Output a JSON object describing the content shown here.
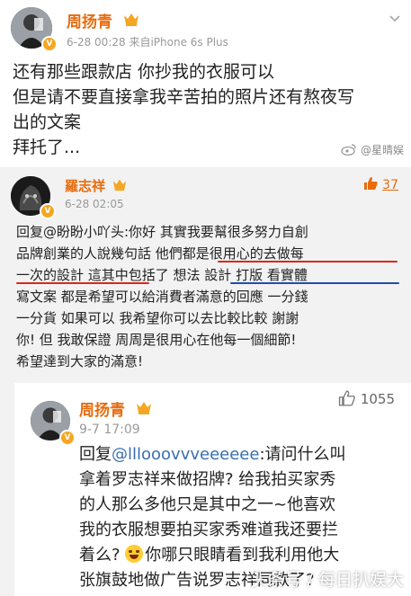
{
  "post1": {
    "username": "周扬青",
    "meta": "6-28 00:28  来自iPhone 6s Plus",
    "lines": [
      "还有那些跟款店 你抄我的衣服可以",
      "但是请不要直接拿我辛苦拍的照片还有熬夜写",
      "出的文案",
      "拜托了..."
    ],
    "watermark": "@星晴娱"
  },
  "post2": {
    "username": "羅志祥",
    "meta": "6-28 02:05",
    "like_count": "37",
    "lines": [
      "回复@盼盼小吖头:你好 其實我要幫很多努力自創",
      "品牌創業的人說幾句話 他們都是很用心的去做每",
      "一次的設計 這其中包括了 想法 設計 打版 看實體",
      "寫文案 都是希望可以給消費者滿意的回應 一分錢",
      "一分貨 如果可以 我希望你可以去比較比較 謝謝",
      "你! 但 我敢保證 周周是很用心在他每一個細節!",
      "希望達到大家的滿意!"
    ]
  },
  "post3": {
    "username": "周扬青",
    "meta": "9-7 17:09",
    "like_count": "1055",
    "reply_prefix": "回复",
    "mention": "@lllooovvveeeeee",
    "line1_rest": ":请问什么叫",
    "lines": [
      "拿着罗志祥来做招牌? 给我拍买家秀",
      "的人那么多他只是其中之一~他喜欢",
      "我的衣服想要拍买家秀难道我还要拦"
    ],
    "line5_before": "着么? ",
    "line5_after": "你哪只眼睛看到我利用他大",
    "line6": "张旗鼓地做广告说罗志祥同款了?",
    "watermark": "头条号 / 每日扒娱大"
  },
  "icons": [
    "chevron-down-icon",
    "verified-badge-icon",
    "thumbs-up-icon",
    "weibo-logo-icon",
    "laugh-cry-emoji-icon"
  ],
  "colors": {
    "username": "#e86b0c",
    "meta": "#999999",
    "mention": "#3a6fb0",
    "underline_red": "#d9271c",
    "underline_blue": "#1f4fa8",
    "quote_bg": "#f2f2f2"
  }
}
